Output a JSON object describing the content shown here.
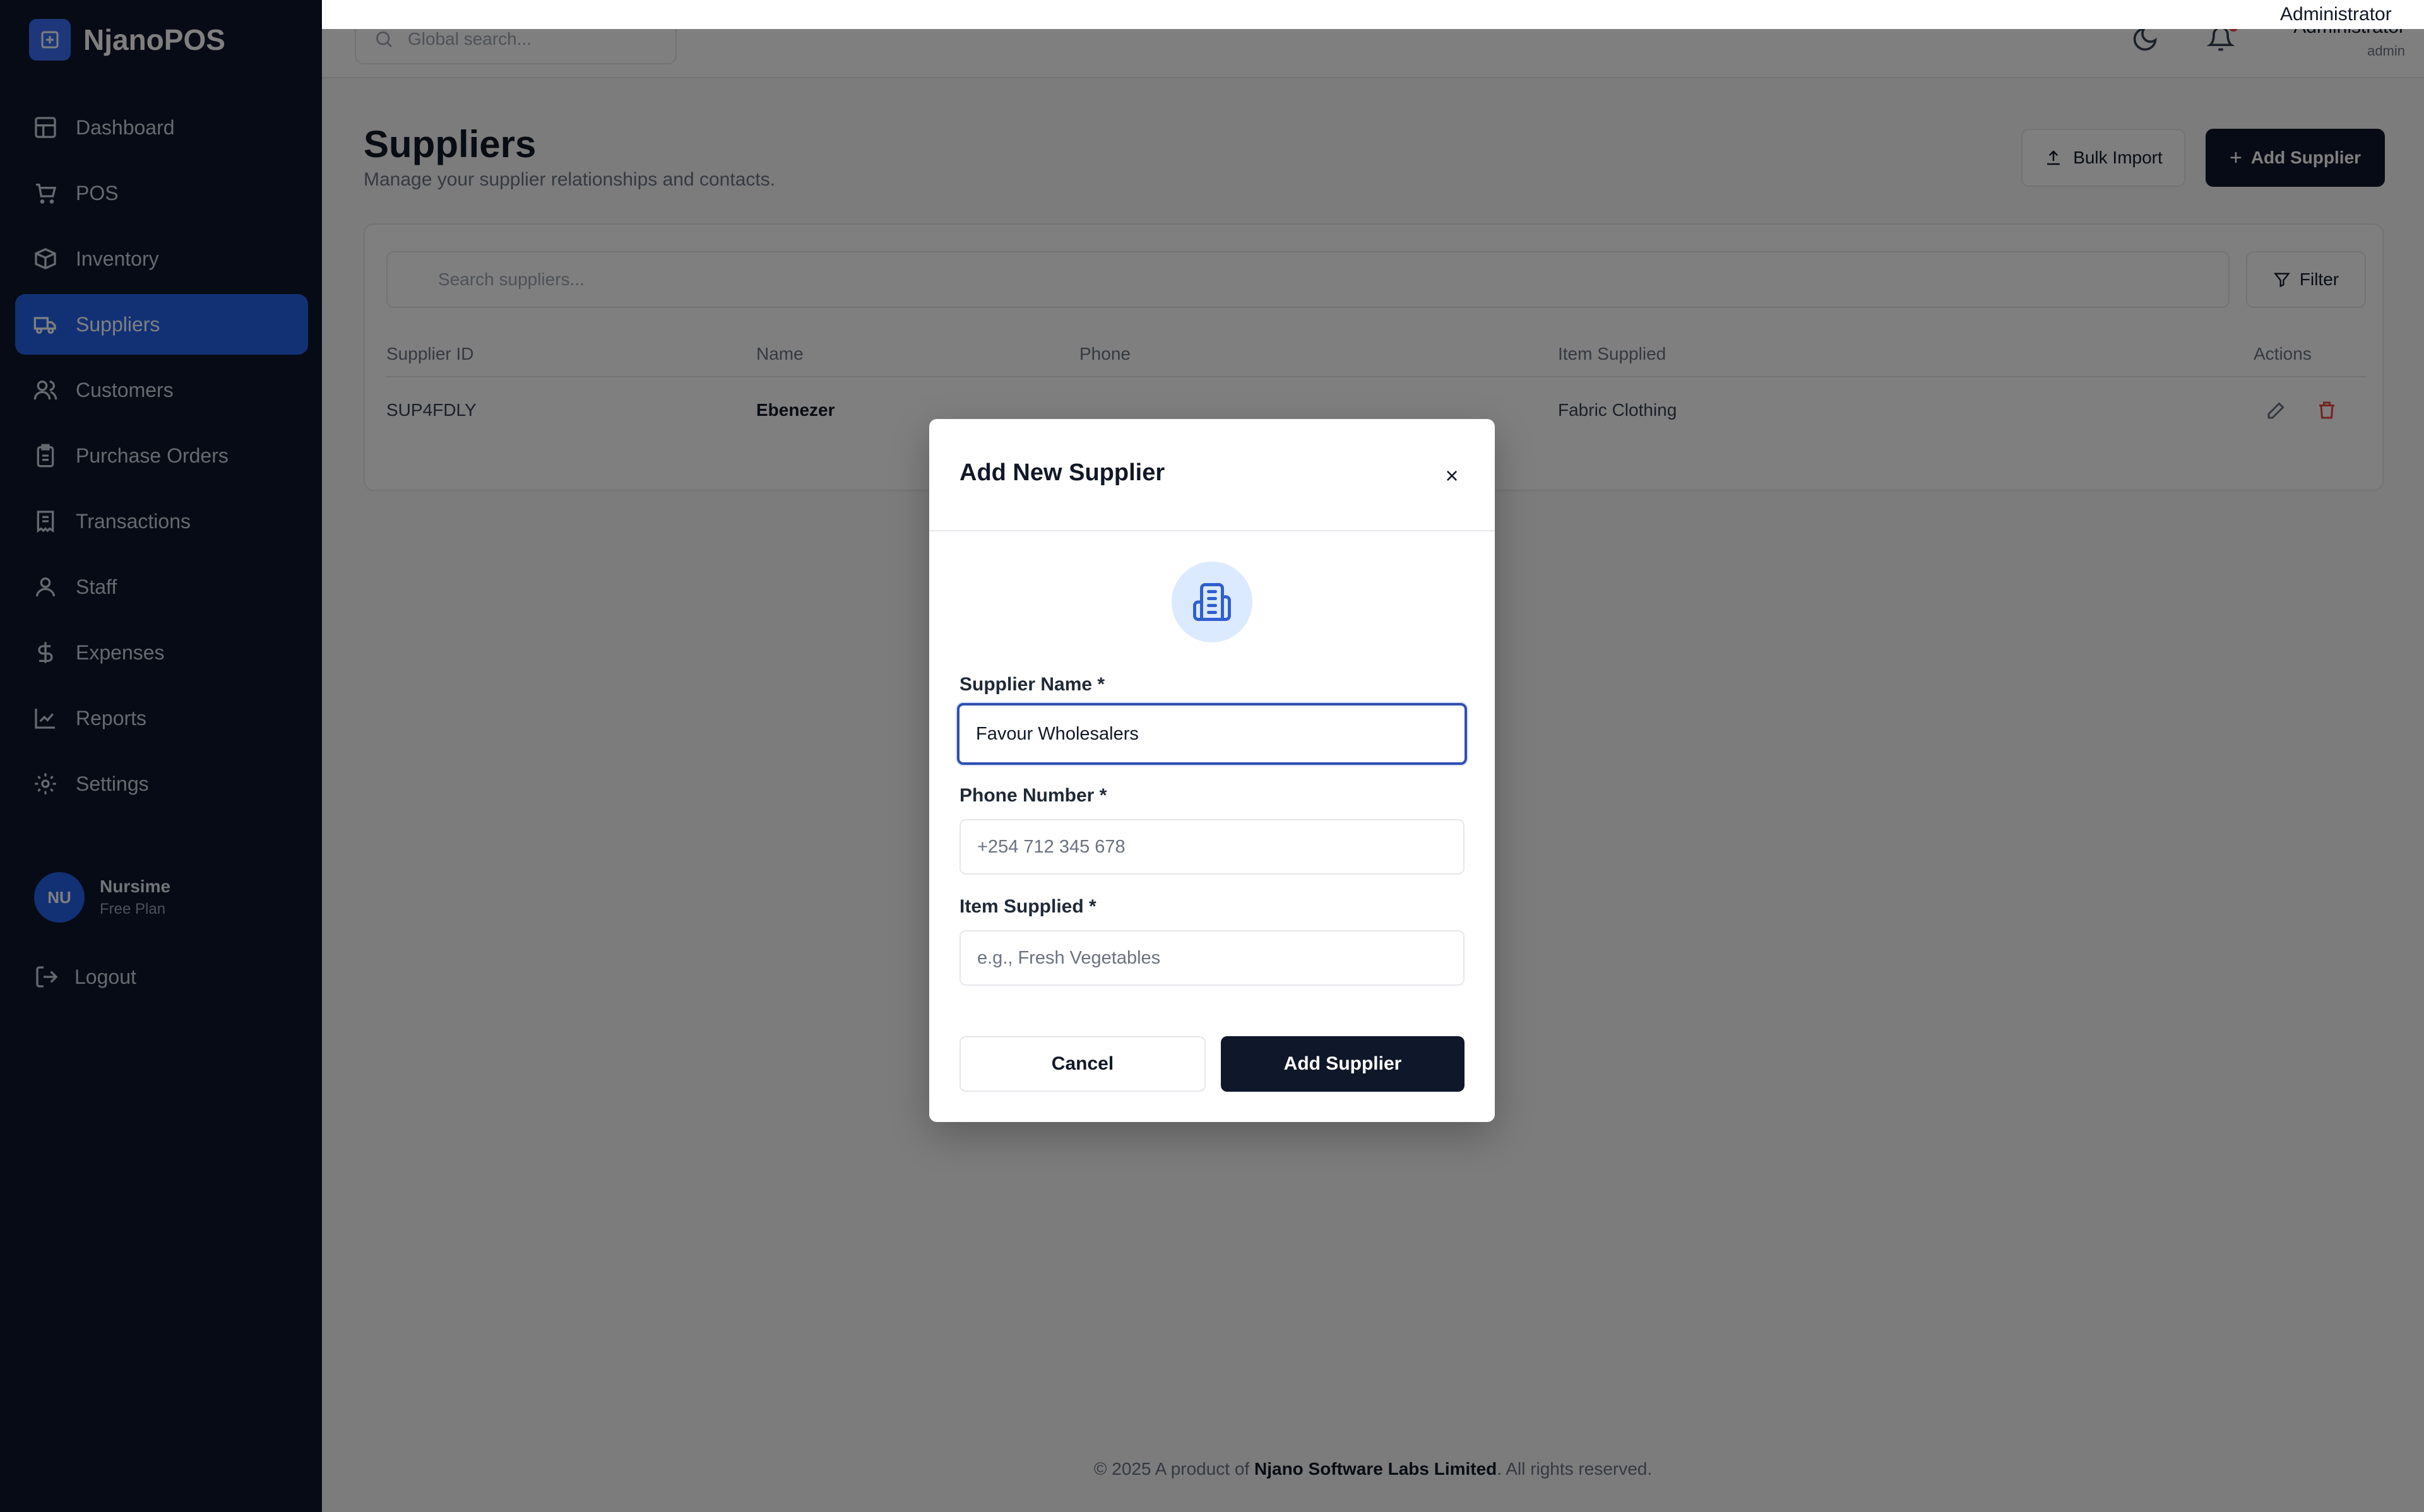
{
  "app": {
    "name": "NjanoPOS"
  },
  "sidebar": {
    "items": [
      {
        "label": "Dashboard",
        "icon": "grid-icon"
      },
      {
        "label": "POS",
        "icon": "cart-icon"
      },
      {
        "label": "Inventory",
        "icon": "box-icon"
      },
      {
        "label": "Suppliers",
        "icon": "truck-icon",
        "active": true
      },
      {
        "label": "Customers",
        "icon": "users-icon"
      },
      {
        "label": "Purchase Orders",
        "icon": "clipboard-icon"
      },
      {
        "label": "Transactions",
        "icon": "receipt-icon"
      },
      {
        "label": "Staff",
        "icon": "user-icon"
      },
      {
        "label": "Expenses",
        "icon": "dollar-icon"
      },
      {
        "label": "Reports",
        "icon": "chart-icon"
      },
      {
        "label": "Settings",
        "icon": "gear-icon"
      }
    ],
    "user": {
      "initials": "NU",
      "name": "Nursime",
      "plan": "Free Plan"
    },
    "logout_label": "Logout"
  },
  "topbar": {
    "search_placeholder": "Global search...",
    "admin_name": "Administrator",
    "admin_role": "admin"
  },
  "page": {
    "title": "Suppliers",
    "subtitle": "Manage your supplier relationships and contacts.",
    "bulk_import_label": "Bulk Import",
    "add_supplier_label": "Add Supplier"
  },
  "table": {
    "search_placeholder": "Search suppliers...",
    "filter_label": "Filter",
    "columns": [
      "Supplier ID",
      "Name",
      "Phone",
      "Item Supplied",
      "Actions"
    ],
    "rows": [
      {
        "id": "SUP4FDLY",
        "name": "Ebenezer",
        "phone": "",
        "item": "Fabric Clothing"
      }
    ]
  },
  "footer": {
    "prefix": "© 2025 A product of",
    "company": "Njano Software Labs Limited",
    "suffix": ". All rights reserved."
  },
  "modal": {
    "title": "Add New Supplier",
    "close_label": "×",
    "fields": {
      "name": {
        "label": "Supplier Name *",
        "value": "Favour Wholesalers"
      },
      "phone": {
        "label": "Phone Number *",
        "placeholder": "+254 712 345 678"
      },
      "item": {
        "label": "Item Supplied *",
        "placeholder": "e.g., Fresh Vegetables"
      }
    },
    "cancel_label": "Cancel",
    "submit_label": "Add Supplier"
  },
  "colors": {
    "sidebar_bg": "#0f172a",
    "accent": "#2563eb",
    "primary_button": "#0f172a",
    "focus_border": "#2f4fb2",
    "notification": "#ef4444"
  }
}
